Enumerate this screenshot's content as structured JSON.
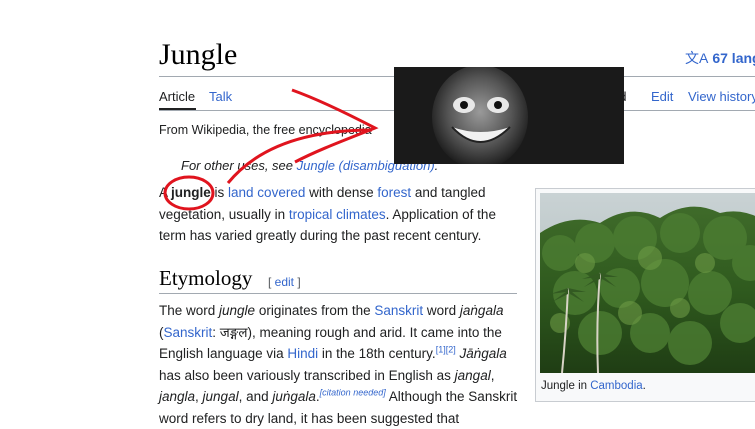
{
  "article": {
    "title": "Jungle",
    "languages_label": "67 lang",
    "languages_icon": "translate-icon",
    "tagline": "From Wikipedia, the free encyclopedia",
    "hatnote_prefix": "For other uses, see ",
    "hatnote_link": "Jungle (disambiguation)",
    "hatnote_suffix": "."
  },
  "tabs": {
    "article": "Article",
    "talk": "Talk",
    "read": "ad",
    "edit": "Edit",
    "history": "View history"
  },
  "lead": {
    "t1": "A ",
    "bold": "jungle",
    "t2": " is ",
    "link1": "land covered",
    "t3": " with dense ",
    "link2": "forest",
    "t4": " and tangled vegetation, usually in ",
    "link3": "tropical climates",
    "t5": ". Application of the term has varied greatly during the past recent century."
  },
  "etymology": {
    "heading": "Etymology",
    "edit_open": "[ ",
    "edit_label": "edit",
    "edit_close": " ]",
    "p1": "The word ",
    "i1": "jungle",
    "p2": " originates from the ",
    "l1": "Sanskrit",
    "p3": " word ",
    "i2": "jaṅgala",
    "p4": " (",
    "l2": "Sanskrit",
    "p5": ": जङ्गल), meaning rough and arid. It came into the English language via ",
    "l3": "Hindi",
    "p6": " in the 18th century.",
    "s1": "[1][2]",
    "p7": " ",
    "i3": "Jāṅgala",
    "p8": " has also been variously transcribed in English as ",
    "i4": "jangal",
    "p9": ", ",
    "i5": "jangla",
    "p10": ", ",
    "i6": "jungal",
    "p11": ", and ",
    "i7": "juṅgala",
    "p12": ".",
    "s2": "[citation needed]",
    "p13": " Although the Sanskrit word refers to dry land, it has been suggested that"
  },
  "infobox": {
    "caption_prefix": "Jungle in ",
    "caption_link": "Cambodia",
    "caption_suffix": "."
  },
  "overlay": {
    "image": "grinning-face-photo"
  },
  "colors": {
    "link": "#3366cc",
    "scribble": "#e0141e",
    "text": "#202122"
  }
}
